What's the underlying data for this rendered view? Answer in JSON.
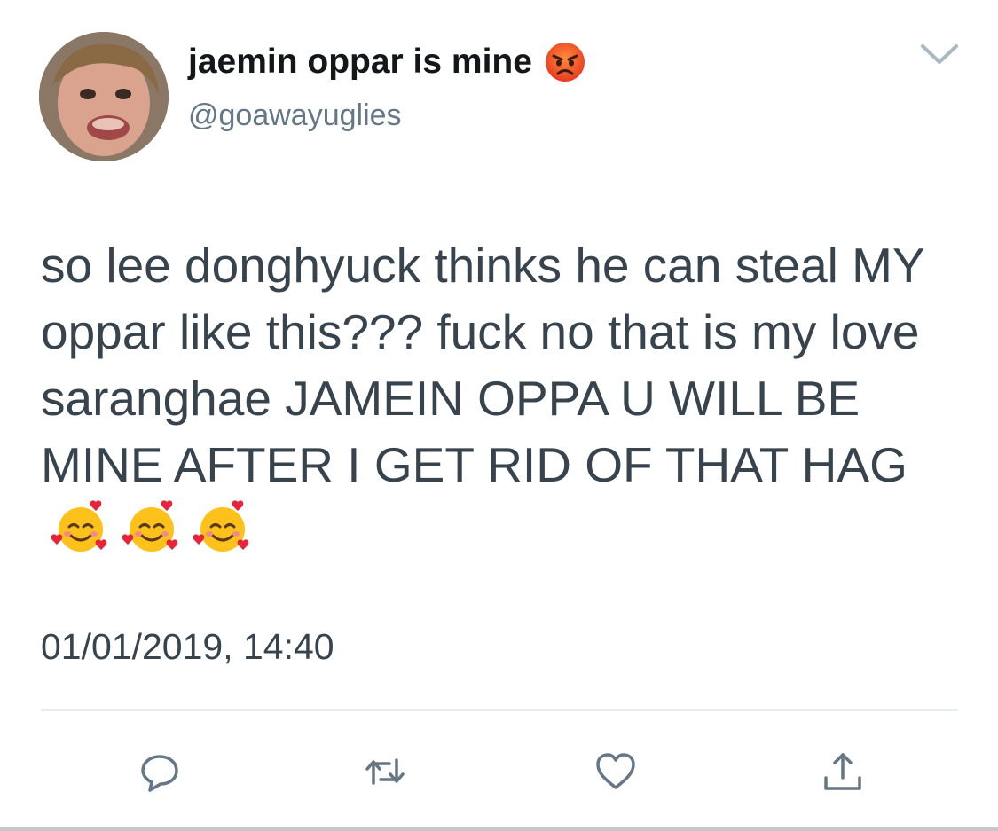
{
  "tweet": {
    "display_name": "jaemin oppar is mine",
    "name_emoji_icon": "pouting-face-icon",
    "handle": "@goawayuglies",
    "text": "so lee donghyuck thinks he can steal MY oppar like this??? fuck no that is my love saranghae JAMEIN OPPA U WILL BE MINE AFTER I GET RID OF THAT HAG",
    "text_emoji_icons": [
      "smiling-face-with-hearts-icon",
      "smiling-face-with-hearts-icon",
      "smiling-face-with-hearts-icon"
    ],
    "timestamp": "01/01/2019, 14:40"
  },
  "actions": [
    {
      "name": "reply",
      "icon": "reply-bubble-icon"
    },
    {
      "name": "retweet",
      "icon": "retweet-icon"
    },
    {
      "name": "like",
      "icon": "heart-icon"
    },
    {
      "name": "share",
      "icon": "share-icon"
    }
  ],
  "colors": {
    "name": "#14171a",
    "handle": "#657786",
    "body_text": "#38444d",
    "icon": "#657786",
    "divider": "#e6ecf0"
  }
}
